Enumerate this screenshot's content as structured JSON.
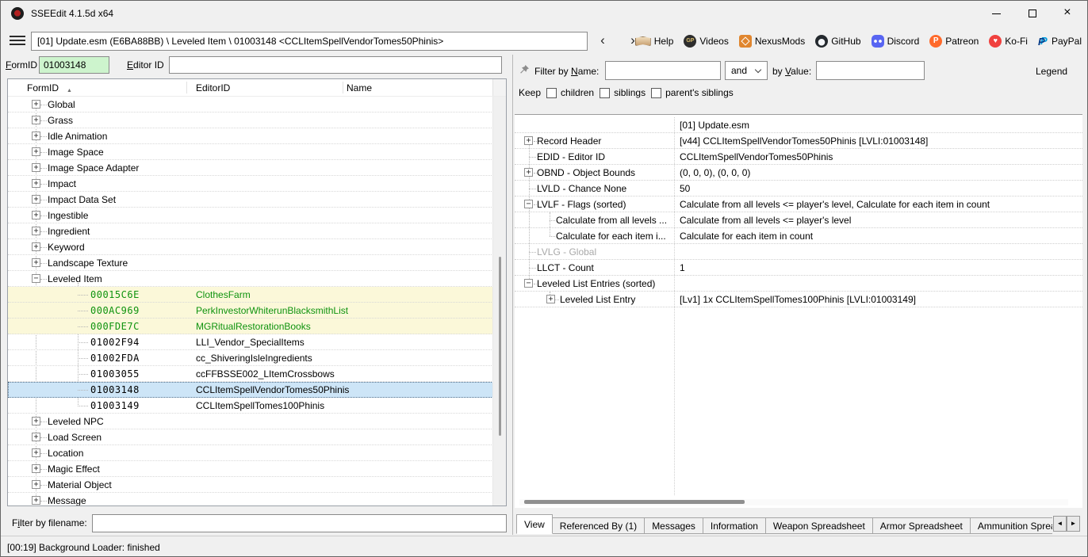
{
  "titlebar": {
    "title": "SSEEdit 4.1.5d x64"
  },
  "toolbar": {
    "path_text": "[01] Update.esm (E6BA88BB) \\ Leveled Item \\ 01003148 <CCLItemSpellVendorTomes50Phinis>",
    "links": [
      {
        "icon": "help-book-icon",
        "label": "Help"
      },
      {
        "icon": "gamerpoets-icon",
        "label": "Videos"
      },
      {
        "icon": "nexusmods-icon",
        "label": "NexusMods"
      },
      {
        "icon": "github-icon",
        "label": "GitHub"
      },
      {
        "icon": "discord-icon",
        "label": "Discord"
      },
      {
        "icon": "patreon-icon",
        "label": "Patreon"
      },
      {
        "icon": "kofi-icon",
        "label": "Ko-Fi"
      },
      {
        "icon": "paypal-icon",
        "label": "PayPal"
      }
    ]
  },
  "fields": {
    "formid_label": {
      "u": "F",
      "rest": "ormID"
    },
    "formid_value": "01003148",
    "editorid_label": {
      "u": "E",
      "rest": "ditor ID"
    },
    "editorid_value": ""
  },
  "left_panel": {
    "columns": [
      "FormID",
      "EditorID",
      "Name"
    ],
    "tree": {
      "rows": [
        {
          "kind": "root",
          "expand": "plus",
          "label": "Global"
        },
        {
          "kind": "root",
          "expand": "plus",
          "label": "Grass"
        },
        {
          "kind": "root",
          "expand": "plus",
          "label": "Idle Animation"
        },
        {
          "kind": "root",
          "expand": "plus",
          "label": "Image Space"
        },
        {
          "kind": "root",
          "expand": "plus",
          "label": "Image Space Adapter"
        },
        {
          "kind": "root",
          "expand": "plus",
          "label": "Impact"
        },
        {
          "kind": "root",
          "expand": "plus",
          "label": "Impact Data Set"
        },
        {
          "kind": "root",
          "expand": "plus",
          "label": "Ingestible"
        },
        {
          "kind": "root",
          "expand": "plus",
          "label": "Ingredient"
        },
        {
          "kind": "root",
          "expand": "plus",
          "label": "Keyword"
        },
        {
          "kind": "root",
          "expand": "plus",
          "label": "Landscape Texture"
        },
        {
          "kind": "root",
          "expand": "minus",
          "label": "Leveled Item"
        },
        {
          "kind": "child",
          "formid": "00015C6E",
          "editorid": "ClothesFarm",
          "state": "new"
        },
        {
          "kind": "child",
          "formid": "000AC969",
          "editorid": "PerkInvestorWhiterunBlacksmithList",
          "state": "new"
        },
        {
          "kind": "child",
          "formid": "000FDE7C",
          "editorid": "MGRitualRestorationBooks",
          "state": "new"
        },
        {
          "kind": "child",
          "formid": "01002F94",
          "editorid": "LLI_Vendor_SpecialItems",
          "state": "normal"
        },
        {
          "kind": "child",
          "formid": "01002FDA",
          "editorid": "cc_ShiveringIsleIngredients",
          "state": "normal"
        },
        {
          "kind": "child",
          "formid": "01003055",
          "editorid": "ccFFBSSE002_LItemCrossbows",
          "state": "normal"
        },
        {
          "kind": "child",
          "formid": "01003148",
          "editorid": "CCLItemSpellVendorTomes50Phinis",
          "state": "selected"
        },
        {
          "kind": "child",
          "formid": "01003149",
          "editorid": "CCLItemSpellTomes100Phinis",
          "state": "normal"
        },
        {
          "kind": "root",
          "expand": "plus",
          "label": "Leveled NPC"
        },
        {
          "kind": "root",
          "expand": "plus",
          "label": "Load Screen"
        },
        {
          "kind": "root",
          "expand": "plus",
          "label": "Location"
        },
        {
          "kind": "root",
          "expand": "plus",
          "label": "Magic Effect"
        },
        {
          "kind": "root",
          "expand": "plus",
          "label": "Material Object"
        },
        {
          "kind": "root",
          "expand": "plus",
          "label": "Message"
        }
      ]
    },
    "filename_filter_label": {
      "pre": "F",
      "u": "i",
      "rest": "lter by filename:"
    },
    "filename_filter_value": ""
  },
  "filter": {
    "name_label": {
      "pre": "Filter by ",
      "u": "N",
      "rest": "ame:"
    },
    "name_value": "",
    "operator": "and",
    "value_label": {
      "pre": "by ",
      "u": "V",
      "rest": "alue:"
    },
    "value_value": "",
    "legend_label": "Legend",
    "keep_label": "Keep",
    "keep_options": [
      "children",
      "siblings",
      "parent's siblings"
    ]
  },
  "record_view": {
    "rows": [
      {
        "label": "",
        "value": "[01] Update.esm",
        "level": 0,
        "expand": "none",
        "gray": false
      },
      {
        "label": "Record Header",
        "value": "[v44] CCLItemSpellVendorTomes50Phinis [LVLI:01003148]",
        "level": 0,
        "expand": "plus",
        "gray": false
      },
      {
        "label": "EDID - Editor ID",
        "value": "CCLItemSpellVendorTomes50Phinis",
        "level": 0,
        "expand": "leaf",
        "gray": false
      },
      {
        "label": "OBND - Object Bounds",
        "value": "(0, 0, 0), (0, 0, 0)",
        "level": 0,
        "expand": "plus",
        "gray": false
      },
      {
        "label": "LVLD - Chance None",
        "value": "50",
        "level": 0,
        "expand": "leaf",
        "gray": false
      },
      {
        "label": "LVLF - Flags (sorted)",
        "value": "Calculate from all levels <= player's level, Calculate for each item in count",
        "level": 0,
        "expand": "minus",
        "gray": false
      },
      {
        "label": "Calculate from all levels ...",
        "value": "Calculate from all levels <= player's level",
        "level": 1,
        "expand": "leaf",
        "gray": false
      },
      {
        "label": "Calculate for each item i...",
        "value": "Calculate for each item in count",
        "level": 1,
        "expand": "leaf",
        "gray": false
      },
      {
        "label": "LVLG - Global",
        "value": "",
        "level": 0,
        "expand": "leaf",
        "gray": true
      },
      {
        "label": "LLCT - Count",
        "value": "1",
        "level": 0,
        "expand": "leaf",
        "gray": false
      },
      {
        "label": "Leveled List Entries (sorted)",
        "value": "",
        "level": 0,
        "expand": "minus",
        "gray": false
      },
      {
        "label": "Leveled List Entry",
        "value": "[Lv1] 1x CCLItemSpellTomes100Phinis [LVLI:01003149]",
        "level": 1,
        "expand": "plus",
        "gray": false
      }
    ]
  },
  "tabs": {
    "items": [
      {
        "label": "View",
        "active": true
      },
      {
        "label": "Referenced By (1)",
        "active": false
      },
      {
        "label": "Messages",
        "active": false
      },
      {
        "label": "Information",
        "active": false
      },
      {
        "label": "Weapon Spreadsheet",
        "active": false
      },
      {
        "label": "Armor Spreadsheet",
        "active": false
      },
      {
        "label": "Ammunition Spreadsheet",
        "active": false
      }
    ],
    "partial_glyph": "W"
  },
  "status_bar": {
    "text": "[00:19] Background Loader: finished"
  }
}
